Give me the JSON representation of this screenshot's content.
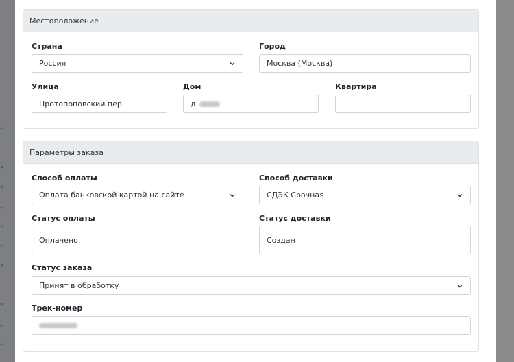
{
  "location": {
    "header": "Местоположение",
    "country": {
      "label": "Страна",
      "value": "Россия"
    },
    "city": {
      "label": "Город",
      "value": "Москва (Москва)"
    },
    "street": {
      "label": "Улица",
      "value": "Протопоповский пер"
    },
    "house": {
      "label": "Дом",
      "value": "д"
    },
    "apartment": {
      "label": "Квартира",
      "value": ""
    }
  },
  "order": {
    "header": "Параметры заказа",
    "payment_method": {
      "label": "Способ оплаты",
      "value": "Оплата банковской картой на сайте"
    },
    "delivery_method": {
      "label": "Способ доставки",
      "value": "СДЭК Срочная"
    },
    "payment_status": {
      "label": "Статус оплаты",
      "value": "Оплачено"
    },
    "delivery_status": {
      "label": "Статус доставки",
      "value": "Создан"
    },
    "order_status": {
      "label": "Статус заказа",
      "value": "Принят в обработку"
    },
    "tracking": {
      "label": "Трек-номер",
      "value": ""
    }
  },
  "colors": {
    "header_bg": "#e9ecef",
    "border": "#ced4da",
    "overlay": "#8a8a8a",
    "link": "#2c4e8a"
  },
  "icons": {
    "select_arrow": "chevron-down-icon"
  }
}
